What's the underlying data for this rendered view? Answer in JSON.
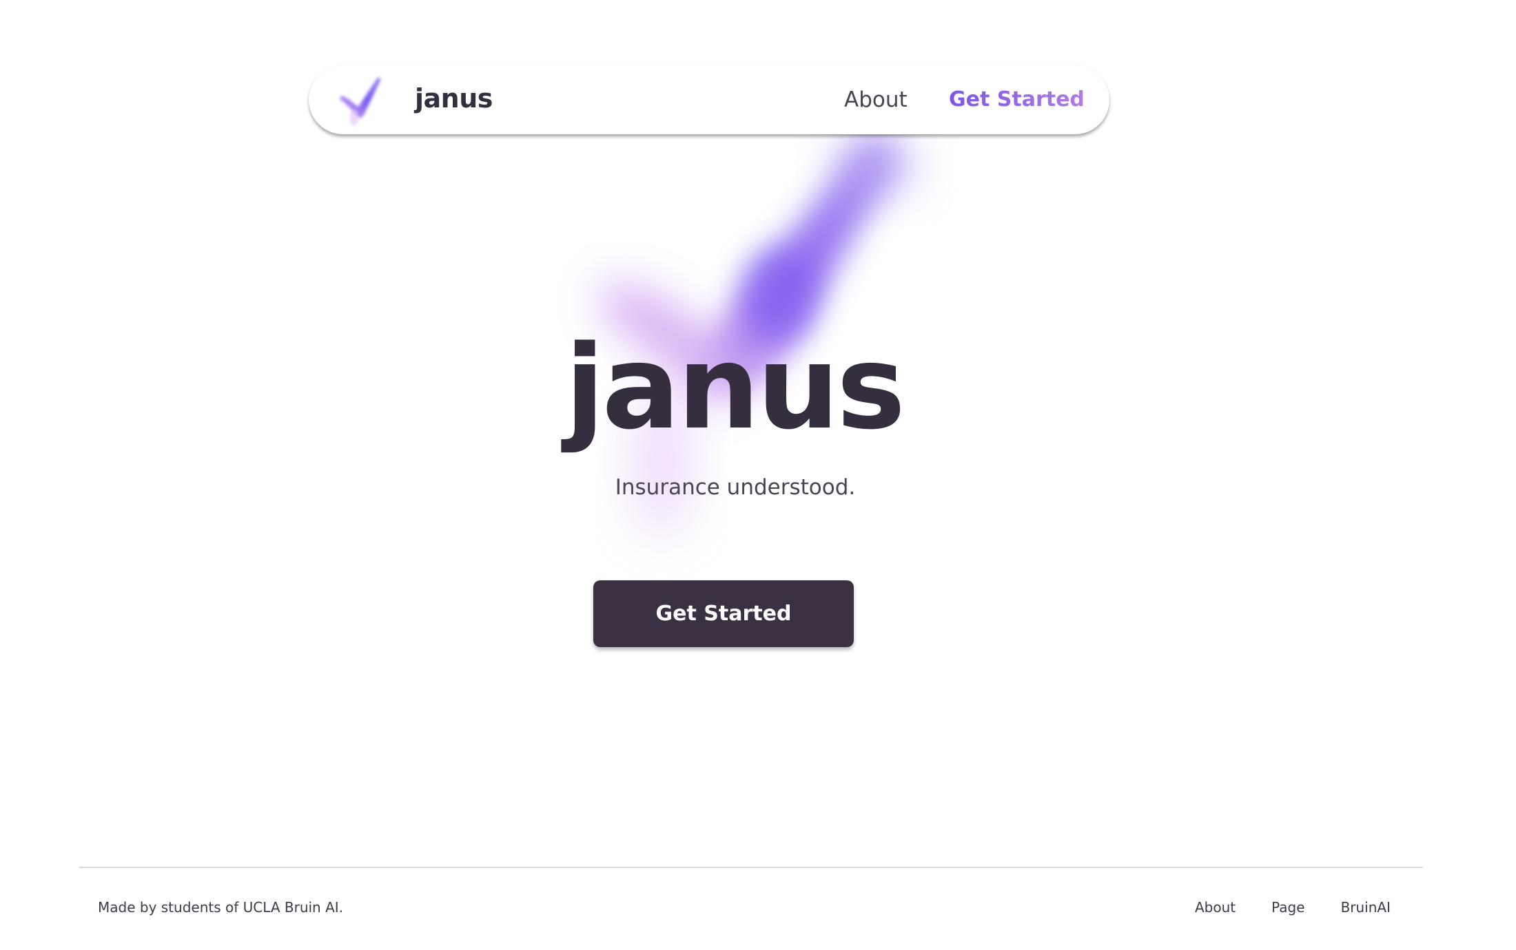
{
  "navbar": {
    "brand": "janus",
    "logo_icon": "checkmark-logo-icon",
    "links": {
      "about": "About",
      "get_started": "Get Started"
    }
  },
  "hero": {
    "title": "janus",
    "tagline": "Insurance understood.",
    "button_label": "Get Started",
    "glow_icon": "checkmark-glow-icon"
  },
  "footer": {
    "credit": "Made by students of UCLA Bruin AI.",
    "links": [
      "About",
      "Page",
      "BruinAI"
    ]
  },
  "colors": {
    "text_dark": "#352e3f",
    "accent_purple": "#7a57e6",
    "accent_light_purple": "#b27ce0",
    "button_bg": "#3a3041",
    "divider": "#d9d9d9",
    "background": "#ffffff"
  }
}
